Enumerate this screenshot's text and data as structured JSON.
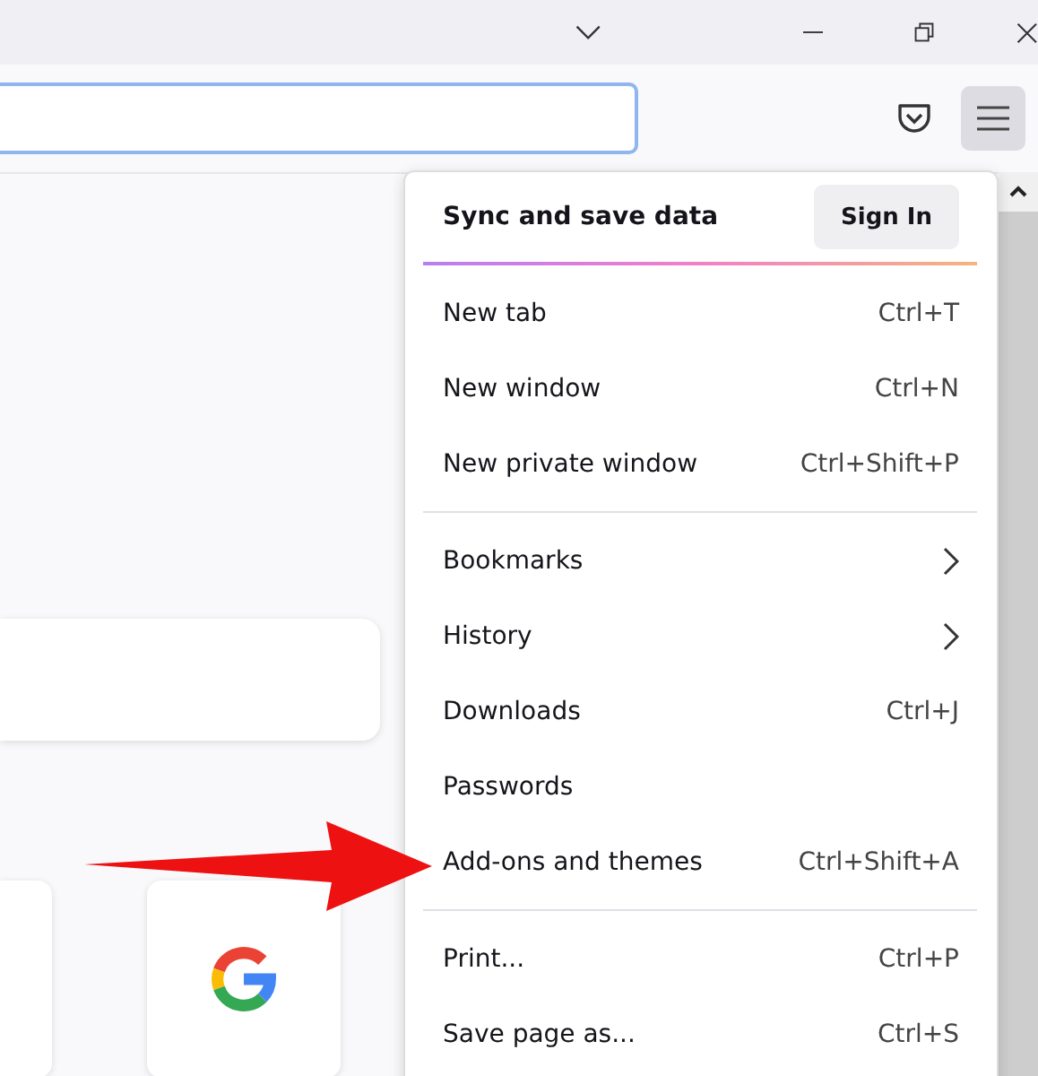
{
  "menu": {
    "header": {
      "title": "Sync and save data",
      "button": "Sign In"
    },
    "sections": [
      [
        {
          "kind": "shortcut",
          "label": "New tab",
          "shortcut": "Ctrl+T"
        },
        {
          "kind": "shortcut",
          "label": "New window",
          "shortcut": "Ctrl+N"
        },
        {
          "kind": "shortcut",
          "label": "New private window",
          "shortcut": "Ctrl+Shift+P"
        }
      ],
      [
        {
          "kind": "submenu",
          "label": "Bookmarks"
        },
        {
          "kind": "submenu",
          "label": "History"
        },
        {
          "kind": "shortcut",
          "label": "Downloads",
          "shortcut": "Ctrl+J"
        },
        {
          "kind": "plain",
          "label": "Passwords"
        },
        {
          "kind": "shortcut",
          "label": "Add-ons and themes",
          "shortcut": "Ctrl+Shift+A"
        }
      ],
      [
        {
          "kind": "shortcut",
          "label": "Print...",
          "shortcut": "Ctrl+P"
        },
        {
          "kind": "shortcut",
          "label": "Save page as...",
          "shortcut": "Ctrl+S"
        }
      ]
    ]
  }
}
